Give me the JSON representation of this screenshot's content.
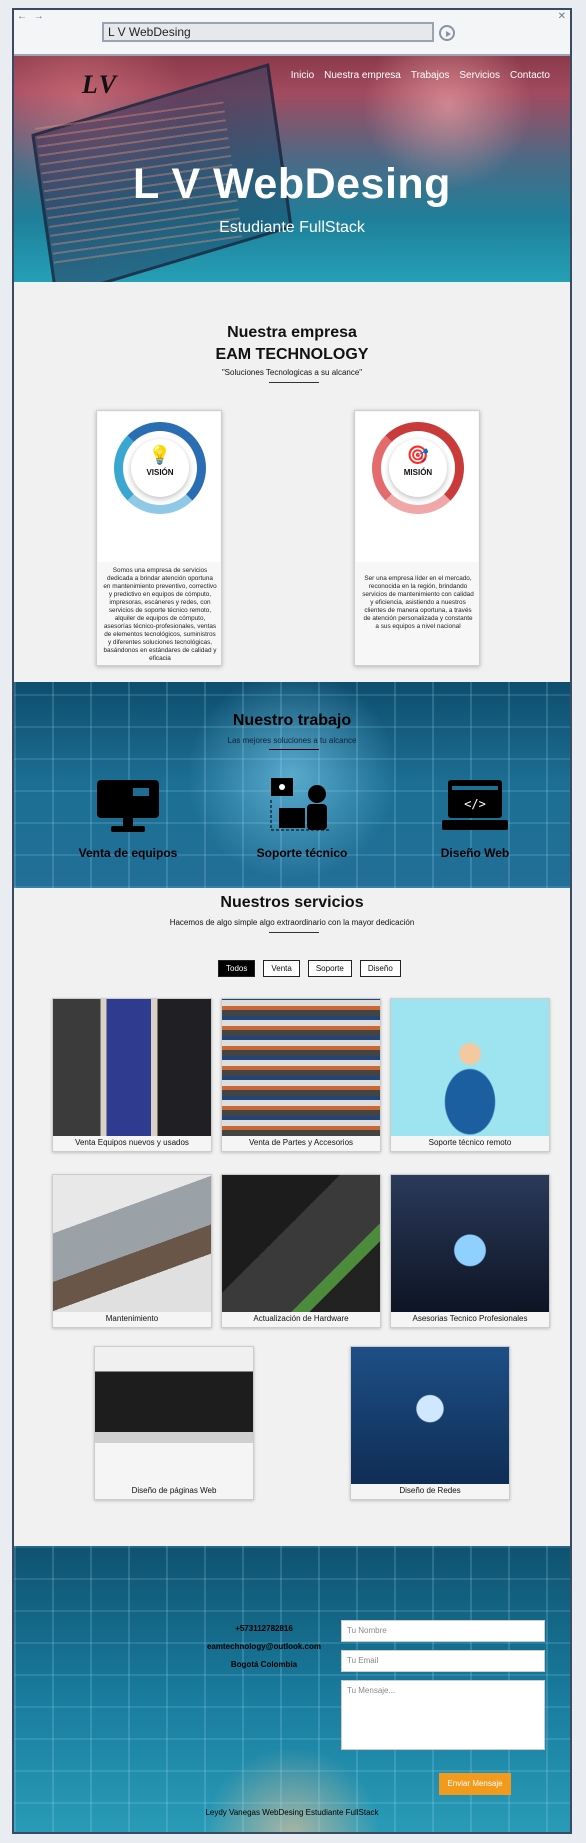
{
  "browser": {
    "nav_arrows": "← →",
    "close": "✕",
    "url": "L V WebDesing"
  },
  "header": {
    "logo": "LV",
    "nav": [
      "Inicio",
      "Nuestra empresa",
      "Trabajos",
      "Servicios",
      "Contacto"
    ],
    "title": "L V WebDesing",
    "subtitle": "Estudiante FullStack"
  },
  "empresa": {
    "heading": "Nuestra empresa",
    "company": "EAM TECHNOLOGY",
    "tagline": "\"Soluciones Tecnologicas a su alcance\"",
    "cards": [
      {
        "label": "VISIÓN",
        "icon": "lightbulb-icon",
        "text": "Somos una empresa de servicios dedicada a brindar atención oportuna en mantenimiento preventivo, correctivo y predictivo en equipos de cómputo, impresoras, escáneres y redes, con servicios de soporte técnico remoto, alquiler de equipos de cómputo, asesorías técnico-profesionales, ventas de elementos tecnológicos, suministros y diferentes soluciones tecnológicas, basándonos en estándares de calidad y eficacia"
      },
      {
        "label": "MISIÓN",
        "icon": "target-icon",
        "text": "Ser una empresa líder en el mercado, reconocida en la región, brindando servicios de mantenimiento con calidad y eficiencia, asistiendo a nuestros clientes de manera oportuna, a través de atención personalizada y constante a sus equipos a nivel nacional"
      }
    ]
  },
  "trabajo": {
    "heading": "Nuestro trabajo",
    "subtitle": "Las mejores soluciones a tu alcance",
    "items": [
      {
        "label": "Venta de equipos",
        "icon": "monitor-icon"
      },
      {
        "label": "Soporte técnico",
        "icon": "technician-icon"
      },
      {
        "label": "Diseño Web",
        "icon": "code-window-icon"
      }
    ]
  },
  "servicios": {
    "heading": "Nuestros servicios",
    "subtitle": "Hacemos de algo simple algo extraordinario con la mayor dedicación",
    "filters": [
      "Todos",
      "Venta",
      "Soporte",
      "Diseño"
    ],
    "active_filter": "Todos",
    "items": [
      "Venta Equipos nuevos y usados",
      "Venta de Partes y Accesorios",
      "Soporte técnico remoto",
      "Mantenimiento",
      "Actualización de Hardware",
      "Asesorias Tecnico Profesionales",
      "Diseño de páginas Web",
      "Diseño de Redes"
    ]
  },
  "contacto": {
    "phone": "+573112782816",
    "email": "eamtechnology@outlook.com",
    "city": "Bogotá Colombia",
    "placeholders": {
      "name": "Tu Nombre",
      "email": "Tu Email",
      "message": "Tu Mensaje..."
    },
    "send": "Enviar Mensaje",
    "footer": "Leydy Vanegas WebDesing Estudiante FullStack"
  },
  "colors": {
    "accent": "#f29a1b",
    "hero_top": "#8b3a4a",
    "hero_bottom": "#25a0b6",
    "section_blue": "#1c6f93"
  }
}
